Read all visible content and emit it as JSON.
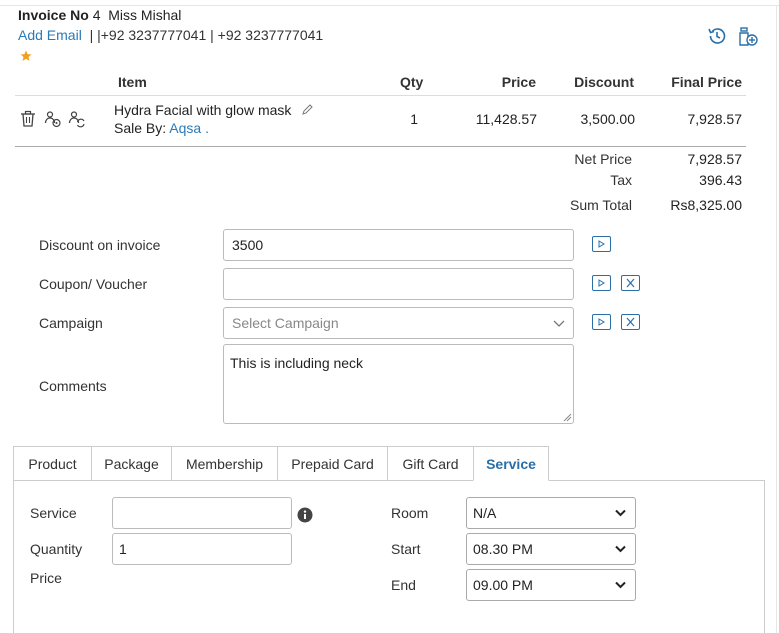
{
  "invoice": {
    "label": "Invoice No",
    "number": "4",
    "customer": "Miss Mishal",
    "add_email": "Add Email",
    "phones": "| |+92 3237777041 | +92 3237777041"
  },
  "table": {
    "headers": {
      "item": "Item",
      "qty": "Qty",
      "price": "Price",
      "discount": "Discount",
      "final": "Final Price"
    },
    "rows": [
      {
        "name": "Hydra Facial with glow mask",
        "sale_by_label": "Sale By:",
        "sale_by": "Aqsa .",
        "qty": "1",
        "price": "11,428.57",
        "discount": "3,500.00",
        "final": "7,928.57"
      }
    ]
  },
  "totals": {
    "net_label": "Net Price",
    "net": "7,928.57",
    "tax_label": "Tax",
    "tax": "396.43",
    "sum_label": "Sum Total",
    "sum": "Rs8,325.00"
  },
  "form": {
    "discount_label": "Discount on invoice",
    "discount_value": "3500",
    "coupon_label": "Coupon/ Voucher",
    "coupon_value": "",
    "campaign_label": "Campaign",
    "campaign_placeholder": "Select Campaign",
    "comments_label": "Comments",
    "comments_value": "This is including neck"
  },
  "tabs": [
    "Product",
    "Package",
    "Membership",
    "Prepaid Card",
    "Gift Card",
    "Service"
  ],
  "active_tab": "Service",
  "service": {
    "service_label": "Service",
    "service_value": "",
    "quantity_label": "Quantity",
    "quantity_value": "1",
    "price_label": "Price",
    "room_label": "Room",
    "room_value": "N/A",
    "start_label": "Start",
    "start_value": "08.30 PM",
    "end_label": "End",
    "end_value": "09.00 PM"
  },
  "colors": {
    "accent": "#2a6fa8",
    "link": "#2a7ab8",
    "star": "#f0a020"
  },
  "icons": [
    "star-icon",
    "history-icon",
    "add-product-icon",
    "trash-icon",
    "staff-icon",
    "staff-swap-icon",
    "pencil-icon",
    "play-icon",
    "close-icon",
    "chevron-down-icon",
    "info-icon"
  ]
}
